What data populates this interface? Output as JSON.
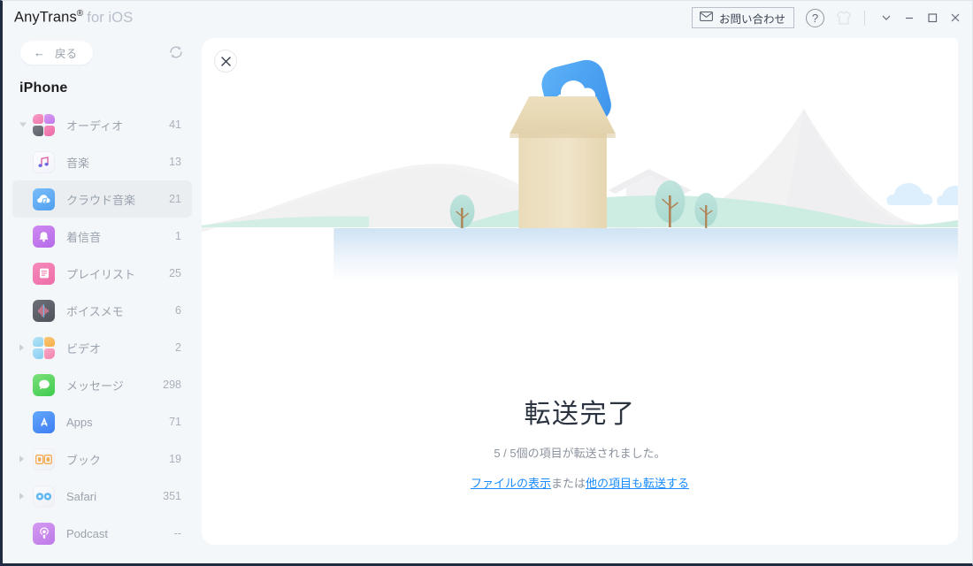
{
  "titlebar": {
    "app_name": "AnyTrans",
    "reg_mark": "®",
    "for_ios": "for iOS",
    "contact_label": "お問い合わせ",
    "mail_icon": "mail-icon",
    "help_icon": "question-mark-icon",
    "shirt_icon": "tshirt-icon",
    "chevron_icon": "chevron-down-icon",
    "minimize_icon": "minimize-icon",
    "maximize_icon": "maximize-icon",
    "close_icon": "close-icon"
  },
  "sidebar": {
    "back_label": "戻る",
    "back_arrow": "←",
    "refresh_icon": "refresh-icon",
    "device_name": "iPhone",
    "items": [
      {
        "label": "オーディオ",
        "count": "41",
        "level": 0,
        "caret": "down",
        "icon": "audio-group-icon",
        "selected": false
      },
      {
        "label": "音楽",
        "count": "13",
        "level": 1,
        "caret": "",
        "icon": "music-icon",
        "selected": false
      },
      {
        "label": "クラウド音楽",
        "count": "21",
        "level": 1,
        "caret": "",
        "icon": "cloud-music-icon",
        "selected": true
      },
      {
        "label": "着信音",
        "count": "1",
        "level": 1,
        "caret": "",
        "icon": "ringtone-icon",
        "selected": false
      },
      {
        "label": "プレイリスト",
        "count": "25",
        "level": 1,
        "caret": "",
        "icon": "playlist-icon",
        "selected": false
      },
      {
        "label": "ボイスメモ",
        "count": "6",
        "level": 1,
        "caret": "",
        "icon": "voice-memo-icon",
        "selected": false
      },
      {
        "label": "ビデオ",
        "count": "2",
        "level": 0,
        "caret": "right",
        "icon": "video-group-icon",
        "selected": false
      },
      {
        "label": "メッセージ",
        "count": "298",
        "level": 0,
        "caret": "",
        "icon": "messages-icon",
        "selected": false
      },
      {
        "label": "Apps",
        "count": "71",
        "level": 0,
        "caret": "",
        "icon": "app-store-icon",
        "selected": false
      },
      {
        "label": "ブック",
        "count": "19",
        "level": 0,
        "caret": "right",
        "icon": "books-icon",
        "selected": false
      },
      {
        "label": "Safari",
        "count": "351",
        "level": 0,
        "caret": "right",
        "icon": "safari-icon",
        "selected": false
      },
      {
        "label": "Podcast",
        "count": "--",
        "level": 0,
        "caret": "",
        "icon": "podcast-icon",
        "selected": false
      }
    ]
  },
  "content": {
    "close_icon": "close-icon",
    "illustration": "transfer-complete-box-landscape-illustration",
    "title": "転送完了",
    "subtitle": "5 / 5個の項目が転送されました。",
    "link_view_files": "ファイルの表示",
    "links_conjunction": "または",
    "link_transfer_more": "他の項目も転送する"
  },
  "colors": {
    "accent_link": "#1a8cff",
    "sidebar_bg": "#f4f7fa",
    "panel_bg": "#ffffff",
    "window_border": "#1f2b40",
    "selected_row": "#eaeef1"
  }
}
